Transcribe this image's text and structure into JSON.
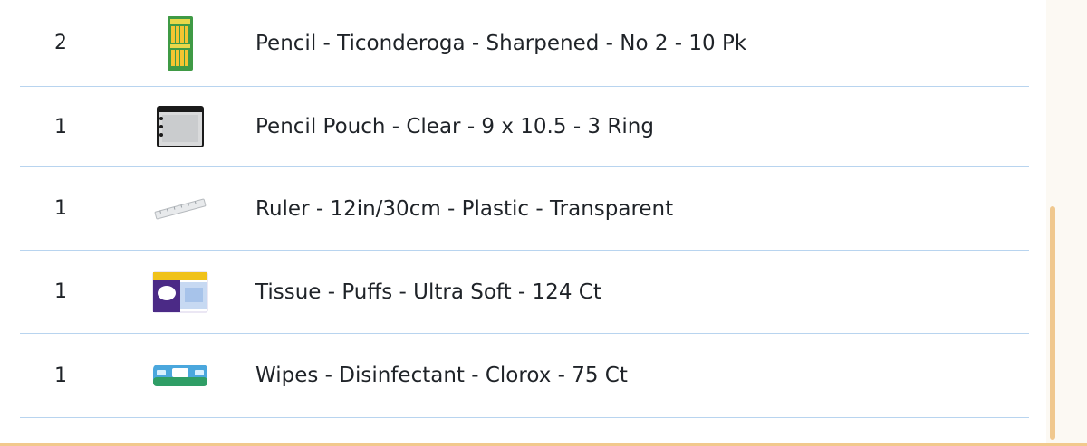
{
  "items": [
    {
      "qty": "2",
      "name": "Pencil - Ticonderoga - Sharpened - No 2 - 10 Pk",
      "icon": "pencil-pack-icon"
    },
    {
      "qty": "1",
      "name": "Pencil Pouch - Clear - 9 x 10.5 - 3 Ring",
      "icon": "pencil-pouch-icon"
    },
    {
      "qty": "1",
      "name": "Ruler - 12in/30cm - Plastic - Transparent",
      "icon": "ruler-icon"
    },
    {
      "qty": "1",
      "name": "Tissue - Puffs - Ultra Soft - 124 Ct",
      "icon": "tissue-box-icon"
    },
    {
      "qty": "1",
      "name": "Wipes - Disinfectant - Clorox - 75 Ct",
      "icon": "wipes-pack-icon"
    }
  ],
  "colors": {
    "divider": "#b8d4ef",
    "scrollbar": "#f0c88e",
    "accent_line": "#f2c98d"
  }
}
